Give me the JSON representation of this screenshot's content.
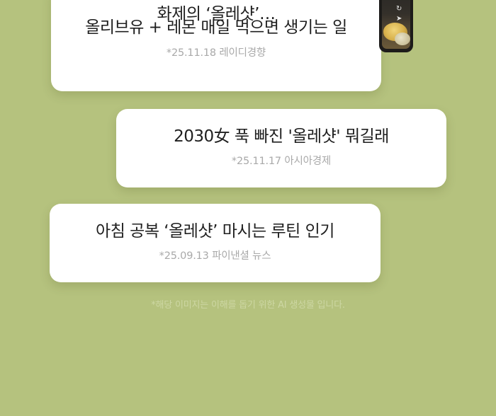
{
  "articles": [
    {
      "headline_line1": "화제의 ‘올레샷’…",
      "headline_line2": "올리브유 + 레몬 매일 먹으면 생기는 일",
      "meta": "*25.11.18 레이디경향"
    },
    {
      "headline": "2030女 푹 빠진 '올레샷' 뭐길래",
      "meta": "*25.11.17 아시아경제"
    },
    {
      "headline": "아침 공복 ‘올레샷’ 마시는 루틴 인기",
      "meta": "*25.09.13 파이낸셜 뉴스"
    }
  ],
  "phone": {
    "icons": [
      "refresh-icon",
      "send-icon"
    ],
    "refresh_glyph": "↻",
    "send_glyph": "➤"
  },
  "disclaimer": "*해당 이미지는 이해를 돕기 위한 AI 생성물 입니다.",
  "colors": {
    "background": "#b5c27e",
    "card": "#ffffff",
    "headline_text": "#1f1f1f",
    "meta_text": "#a9a9a9",
    "disclaimer_text": "#cdd7a3"
  }
}
